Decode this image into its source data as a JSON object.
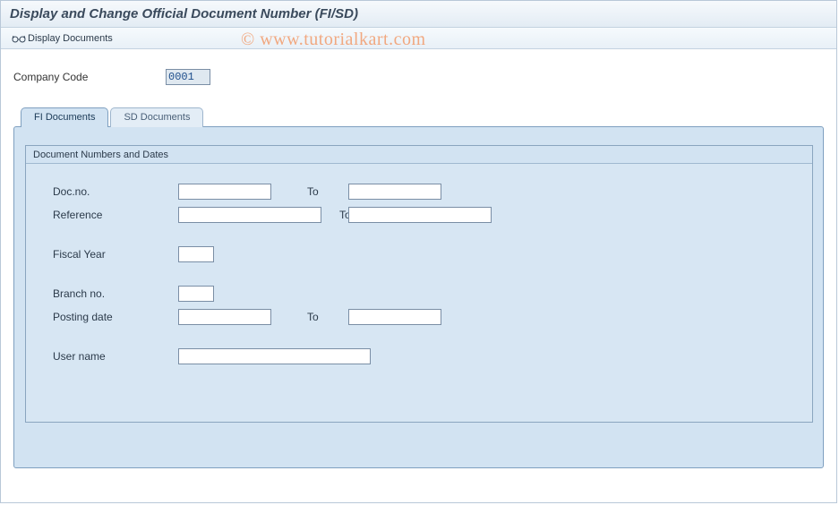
{
  "title": "Display and Change Official Document Number (FI/SD)",
  "watermark": "© www.tutorialkart.com",
  "toolbar": {
    "display_documents": "Display Documents"
  },
  "top_fields": {
    "company_code_label": "Company Code",
    "company_code_value": "0001"
  },
  "tabs": {
    "fi": "FI Documents",
    "sd": "SD Documents"
  },
  "groupbox": {
    "title": "Document Numbers and Dates",
    "fields": {
      "doc_no_label": "Doc.no.",
      "doc_no_from": "",
      "doc_no_to": "",
      "reference_label": "Reference",
      "reference_from": "",
      "reference_to": "",
      "fiscal_year_label": "Fiscal Year",
      "fiscal_year": "",
      "branch_no_label": "Branch no.",
      "branch_no": "",
      "posting_date_label": "Posting date",
      "posting_date_from": "",
      "posting_date_to": "",
      "user_name_label": "User name",
      "user_name": "",
      "to_label": "To"
    }
  }
}
